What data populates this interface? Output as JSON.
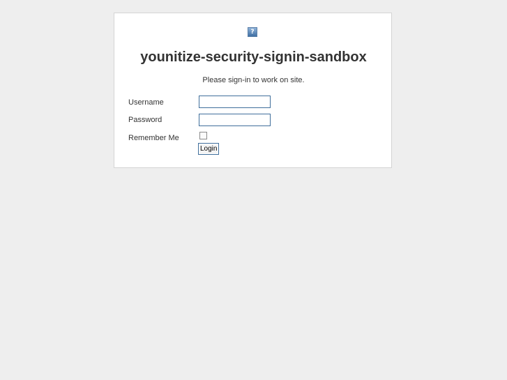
{
  "header": {
    "logo_icon": "help-question-icon",
    "logo_glyph": "?",
    "site_title": "younitize-security-signin-sandbox"
  },
  "intro_text": "Please sign-in to work on site.",
  "form": {
    "username": {
      "label": "Username",
      "value": ""
    },
    "password": {
      "label": "Password",
      "value": ""
    },
    "remember_me": {
      "label": "Remember Me",
      "checked": false
    },
    "login_button_label": "Login"
  },
  "colors": {
    "page_background": "#eeeeee",
    "panel_background": "#ffffff",
    "panel_border": "#d4d4d4",
    "input_border": "#3f6e9b",
    "text": "#333333"
  }
}
